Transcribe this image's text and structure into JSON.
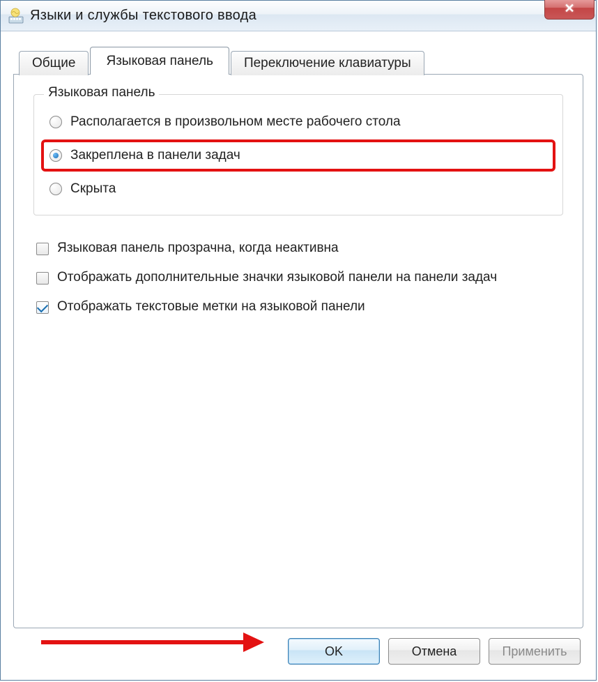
{
  "window": {
    "title": "Языки и службы текстового ввода"
  },
  "tabs": {
    "general": "Общие",
    "langbar": "Языковая панель",
    "switch": "Переключение клавиатуры"
  },
  "group": {
    "title": "Языковая панель",
    "radio_float": "Располагается в произвольном месте рабочего стола",
    "radio_docked": "Закреплена в панели задач",
    "radio_hidden": "Скрыта"
  },
  "checks": {
    "transparent": "Языковая панель прозрачна, когда неактивна",
    "extra_icons": "Отображать дополнительные значки языковой панели на панели задач",
    "text_labels": "Отображать текстовые метки на языковой панели"
  },
  "buttons": {
    "ok": "OK",
    "cancel": "Отмена",
    "apply": "Применить"
  }
}
